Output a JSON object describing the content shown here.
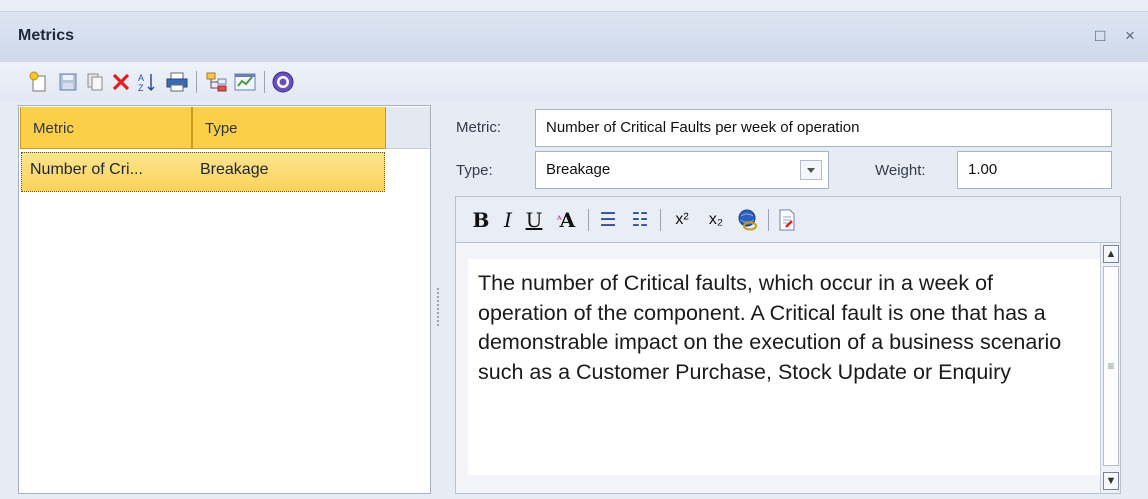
{
  "window": {
    "title": "Metrics",
    "maximize_glyph": "□",
    "close_glyph": "×"
  },
  "toolbar": {
    "buttons": [
      {
        "name": "new-icon",
        "glyph": "✦",
        "color": "#e2a412"
      },
      {
        "name": "save-icon",
        "glyph": "▤",
        "color": "#6a7fb0"
      },
      {
        "name": "copy-icon",
        "glyph": "❐",
        "color": "#8c8c8c"
      },
      {
        "name": "delete-icon",
        "glyph": "✕",
        "color": "#e0201c"
      },
      {
        "name": "sort-icon",
        "glyph": "⇅",
        "color": "#2a4f9a"
      },
      {
        "name": "print-icon",
        "glyph": "⎙",
        "color": "#3b6ab5"
      },
      {
        "name": "hierarchy-icon",
        "glyph": "⊞",
        "color": "#c08a1a"
      },
      {
        "name": "report-icon",
        "glyph": "▦",
        "color": "#4a9a4a"
      },
      {
        "name": "help-icon",
        "glyph": "?",
        "color": "#ffffff"
      }
    ]
  },
  "list": {
    "columns": [
      "Metric",
      "Type"
    ],
    "rows": [
      {
        "metric": "Number of Cri...",
        "type": "Breakage"
      }
    ]
  },
  "form": {
    "metric_label": "Metric:",
    "metric_value": "Number of Critical Faults per week of operation",
    "type_label": "Type:",
    "type_value": "Breakage",
    "weight_label": "Weight:",
    "weight_value": "1.00"
  },
  "editor_toolbar": {
    "bold": "B",
    "italic": "I",
    "underline": "U",
    "font_color": "A",
    "bullet_list": "☰",
    "numbered_list": "☷",
    "superscript": "x²",
    "subscript": "x₂",
    "hyperlink": "⊕",
    "document": "▤"
  },
  "editor": {
    "text": "The number of Critical faults, which occur in a week of operation of the component. A Critical fault is one that has a demonstrable impact on the execution of a business scenario such as a Customer Purchase, Stock Update or Enquiry"
  },
  "colors": {
    "selection": "#fbd35a",
    "header": "#fccf48"
  }
}
